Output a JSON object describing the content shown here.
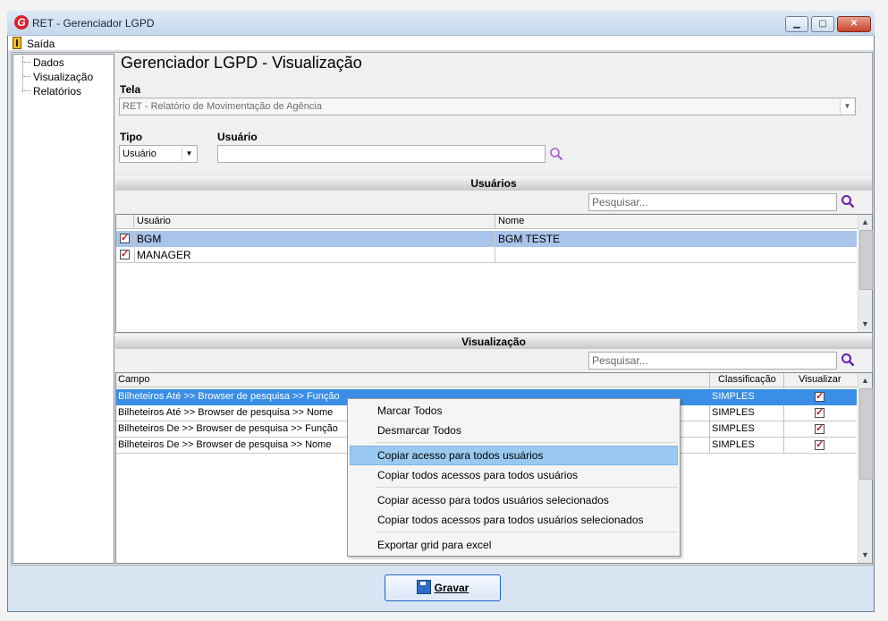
{
  "window": {
    "app_icon_letter": "G",
    "title": "RET - Gerenciador LGPD",
    "minimize": "▁",
    "maximize": "▢",
    "close": "✕"
  },
  "menu": {
    "exit_label": "Saída"
  },
  "tree": {
    "items": [
      "Dados",
      "Visualização",
      "Relatórios"
    ]
  },
  "page": {
    "title": "Gerenciador LGPD - Visualização"
  },
  "tela": {
    "label": "Tela",
    "value": "RET - Relatório de Movimentação de Agência"
  },
  "tipo": {
    "label": "Tipo",
    "value": "Usuário"
  },
  "usuario": {
    "label": "Usuário",
    "value": ""
  },
  "usuarios_section": {
    "title": "Usuários",
    "search_placeholder": "Pesquisar...",
    "columns": [
      "Usuário",
      "Nome"
    ],
    "rows": [
      {
        "usuario": "BGM",
        "nome": "BGM TESTE",
        "checked": true
      },
      {
        "usuario": "MANAGER",
        "nome": "",
        "checked": true
      }
    ]
  },
  "visualizacao_section": {
    "title": "Visualização",
    "search_placeholder": "Pesquisar...",
    "columns": [
      "Campo",
      "Classificação",
      "Visualizar"
    ],
    "rows": [
      {
        "campo": "Bilheteiros Até >> Browser de pesquisa >> Função",
        "classificacao": "SIMPLES",
        "visualizar": true
      },
      {
        "campo": "Bilheteiros Até >> Browser de pesquisa >> Nome",
        "classificacao": "SIMPLES",
        "visualizar": true
      },
      {
        "campo": "Bilheteiros De >> Browser de pesquisa >> Função",
        "classificacao": "SIMPLES",
        "visualizar": true
      },
      {
        "campo": "Bilheteiros De >> Browser de pesquisa >> Nome",
        "classificacao": "SIMPLES",
        "visualizar": true
      }
    ]
  },
  "context_menu": {
    "items": [
      "Marcar Todos",
      "Desmarcar Todos",
      "Copiar acesso para todos usuários",
      "Copiar todos acessos para todos usuários",
      "Copiar acesso para todos usuários selecionados",
      "Copiar todos acessos para todos usuários selecionados",
      "Exportar grid para excel"
    ],
    "highlighted": "Copiar acesso para todos usuários"
  },
  "footer": {
    "save_label": "Gravar"
  },
  "icons": {
    "search": "search-icon",
    "dropdown": "chevron-down-icon",
    "scroll_up": "chevron-up-icon",
    "scroll_down": "chevron-down-icon"
  }
}
